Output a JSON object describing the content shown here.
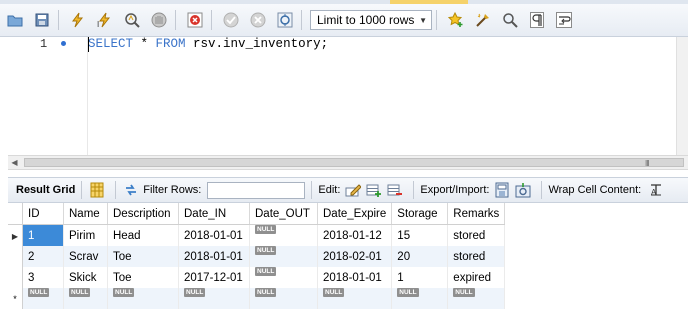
{
  "toolbar": {
    "limit_select_value": "Limit to 1000 rows",
    "buttons": [
      "open-file-icon",
      "save-icon",
      "execute-icon",
      "execute-current-icon",
      "explain-icon",
      "stop-icon",
      "toggle-continue-on-error-icon",
      "commit-icon",
      "rollback-icon",
      "autocommit-icon",
      "add-snippet-icon",
      "beautify-icon",
      "find-icon",
      "invisible-chars-icon",
      "wrap-icon"
    ]
  },
  "editor": {
    "line_number": "1",
    "kw_select": "SELECT",
    "star": " * ",
    "kw_from": "FROM",
    "target": " rsv.inv_inventory;"
  },
  "scrollbar": {
    "grip": "III"
  },
  "result_toolbar": {
    "result_grid_label": "Result Grid",
    "filter_label": "Filter Rows:",
    "edit_label": "Edit:",
    "export_label": "Export/Import:",
    "wrap_label": "Wrap Cell Content:"
  },
  "grid": {
    "columns": [
      "ID",
      "Name",
      "Description",
      "Date_IN",
      "Date_OUT",
      "Date_Expire",
      "Storage",
      "Remarks"
    ],
    "rows": [
      [
        "1",
        "Pirim",
        "Head",
        "2018-01-01",
        "NULL",
        "2018-01-12",
        "15",
        "stored"
      ],
      [
        "2",
        "Scrav",
        "Toe",
        "2018-01-01",
        "NULL",
        "2018-02-01",
        "20",
        "stored"
      ],
      [
        "3",
        "Skick",
        "Toe",
        "2017-12-01",
        "NULL",
        "2018-01-01",
        "1",
        "expired"
      ]
    ],
    "new_row": [
      "NULL",
      "NULL",
      "NULL",
      "NULL",
      "NULL",
      "NULL",
      "NULL",
      "NULL"
    ],
    "null_text": "NULL",
    "new_row_marker": "*"
  },
  "colors": {
    "keyword": "#3b74c9",
    "selection": "#3c8ad8",
    "alt_row": "#eef4fb",
    "null_badge": "#8f8f8f"
  }
}
